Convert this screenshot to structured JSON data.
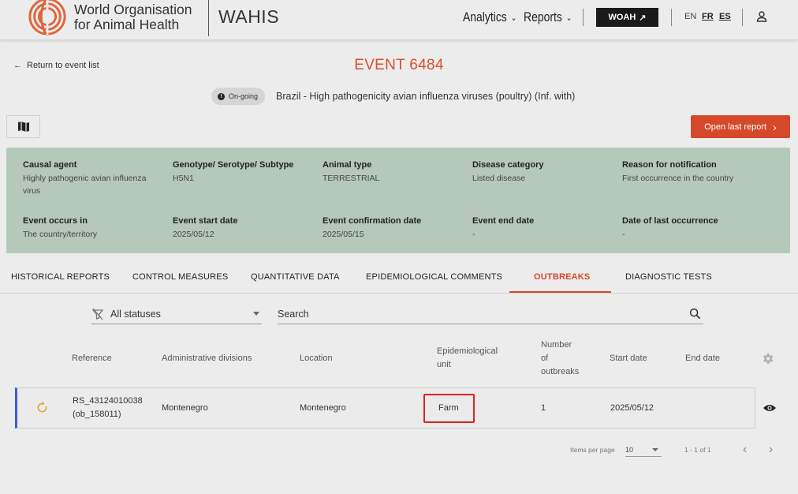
{
  "header": {
    "org_name_line1": "World Organisation",
    "org_name_line2": "for Animal Health",
    "app_name": "WAHIS",
    "nav": {
      "analytics": "Analytics",
      "reports": "Reports",
      "woah": "WOAH"
    },
    "languages": [
      "EN",
      "FR",
      "ES"
    ]
  },
  "event": {
    "back_label": "Return to event list",
    "title": "EVENT 6484",
    "status": "On-going",
    "subtitle": "Brazil - High pathogenicity avian influenza viruses (poultry) (Inf. with)",
    "open_report_label": "Open last report"
  },
  "info": {
    "causal_agent": {
      "label": "Causal agent",
      "value": "Highly pathogenic avian influenza virus"
    },
    "genotype": {
      "label": "Genotype/ Serotype/ Subtype",
      "value": "H5N1"
    },
    "animal_type": {
      "label": "Animal type",
      "value": "TERRESTRIAL"
    },
    "disease_category": {
      "label": "Disease category",
      "value": "Listed disease"
    },
    "reason": {
      "label": "Reason for notification",
      "value": "First occurrence in the country"
    },
    "event_occurs": {
      "label": "Event occurs in",
      "value": "The country/territory"
    },
    "start_date": {
      "label": "Event start date",
      "value": "2025/05/12"
    },
    "confirmation_date": {
      "label": "Event confirmation date",
      "value": "2025/05/15"
    },
    "end_date": {
      "label": "Event end date",
      "value": "-"
    },
    "last_occurrence": {
      "label": "Date of last occurrence",
      "value": "-"
    }
  },
  "tabs": [
    "HISTORICAL REPORTS",
    "CONTROL MEASURES",
    "QUANTITATIVE DATA",
    "EPIDEMIOLOGICAL COMMENTS",
    "OUTBREAKS",
    "DIAGNOSTIC TESTS"
  ],
  "active_tab": "OUTBREAKS",
  "filters": {
    "status_value": "All statuses",
    "search_placeholder": "Search"
  },
  "table": {
    "headers": {
      "reference": "Reference",
      "admin": "Administrative divisions",
      "location": "Location",
      "epi_line1": "Epidemiological",
      "epi_line2": "unit",
      "num_line1": "Number",
      "num_line2": "of",
      "num_line3": "outbreaks",
      "start": "Start date",
      "end": "End date"
    },
    "rows": [
      {
        "reference_line1": "RS_43124010038",
        "reference_line2": "(ob_158011)",
        "admin": "Montenegro",
        "location": "Montenegro",
        "epi_unit": "Farm",
        "num_outbreaks": "1",
        "start_date": "2025/05/12",
        "end_date": ""
      }
    ]
  },
  "pagination": {
    "items_per_page_label": "Items per page",
    "items_per_page": "10",
    "range": "1 - 1 of 1"
  },
  "colors": {
    "accent": "#d5492a",
    "panel": "#b5c9ba",
    "row_marker": "#3b5bd6",
    "highlight": "#e02020"
  }
}
